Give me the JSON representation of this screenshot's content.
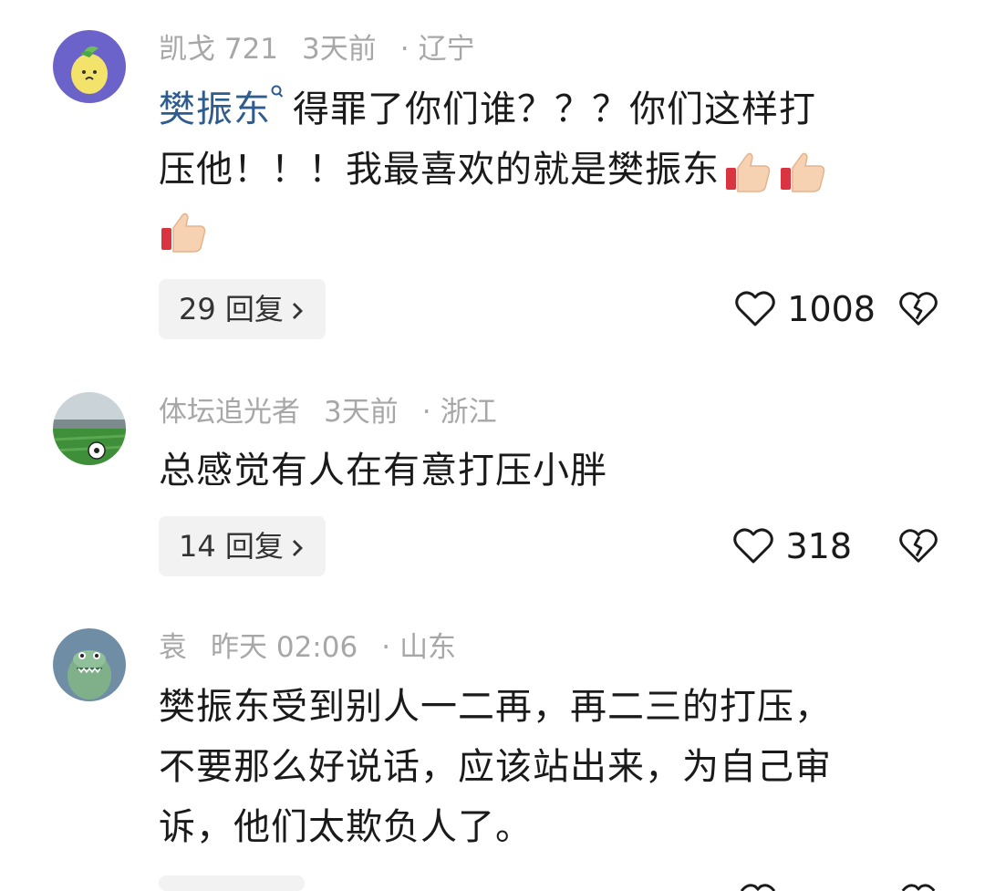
{
  "comments": [
    {
      "user": "凯戈 721",
      "time": "3天前",
      "location": "辽宁",
      "mention": "樊振东",
      "line1": "得罪了你们谁？？？你们这样打",
      "line2": "压他！！！我最喜欢的就是樊振东",
      "reply_label": "29 回复",
      "likes": "1008",
      "avatar_icon": "lemon-avatar-icon"
    },
    {
      "user": "体坛追光者",
      "time": "3天前",
      "location": "浙江",
      "text": "总感觉有人在有意打压小胖",
      "reply_label": "14 回复",
      "likes": "318",
      "avatar_icon": "stadium-avatar-icon"
    },
    {
      "user": "袁",
      "time": "昨天 02:06",
      "location": "山东",
      "line1": "樊振东受到别人一二再，再二三的打压，",
      "line2": "不要那么好说话，应该站出来，为自己审",
      "line3": "诉，他们太欺负人了。",
      "avatar_icon": "crocodile-avatar-icon"
    }
  ],
  "separator": "·",
  "colors": {
    "mention": "#2f5c8f",
    "meta": "#a7a7a7",
    "text": "#1a1a1a",
    "reply_bg": "#f2f2f2"
  }
}
